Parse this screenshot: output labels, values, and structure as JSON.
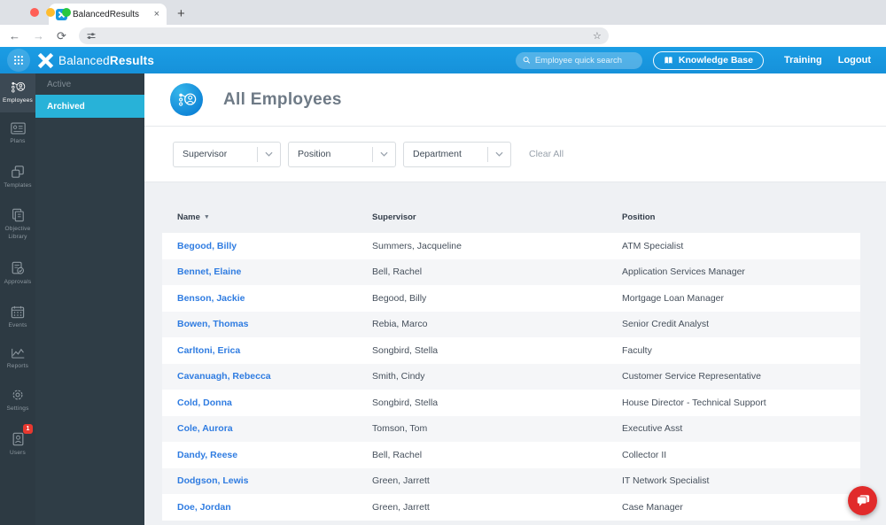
{
  "browser": {
    "tab_title": "BalancedResults",
    "url_value": "",
    "new_tab_label": "+",
    "close_tab_label": "×"
  },
  "header": {
    "brand_first": "Balanced",
    "brand_second": "Results",
    "search_placeholder": "Employee quick search",
    "knowledge_base_label": "Knowledge Base",
    "training_label": "Training",
    "logout_label": "Logout"
  },
  "sidebar": {
    "items": [
      {
        "label": "Employees",
        "active": true
      },
      {
        "label": "Plans"
      },
      {
        "label": "Templates"
      },
      {
        "label": "Objective Library"
      },
      {
        "label": "Approvals"
      },
      {
        "label": "Events"
      },
      {
        "label": "Reports"
      },
      {
        "label": "Settings"
      },
      {
        "label": "Users",
        "badge": "1"
      }
    ]
  },
  "submenu": {
    "items": [
      {
        "label": "Active"
      },
      {
        "label": "Archived",
        "active": true
      }
    ]
  },
  "page": {
    "title": "All Employees"
  },
  "filters": {
    "dropdowns": [
      "Supervisor",
      "Position",
      "Department"
    ],
    "clear_all_label": "Clear All"
  },
  "table": {
    "columns": [
      "Name",
      "Supervisor",
      "Position"
    ],
    "sorted_column": "Name",
    "sort_direction": "asc",
    "rows": [
      {
        "name": "Begood, Billy",
        "supervisor": "Summers, Jacqueline",
        "position": "ATM Specialist"
      },
      {
        "name": "Bennet, Elaine",
        "supervisor": "Bell, Rachel",
        "position": "Application Services Manager"
      },
      {
        "name": "Benson, Jackie",
        "supervisor": "Begood, Billy",
        "position": "Mortgage Loan Manager"
      },
      {
        "name": "Bowen, Thomas",
        "supervisor": "Rebia, Marco",
        "position": "Senior Credit Analyst"
      },
      {
        "name": "Carltoni, Erica",
        "supervisor": "Songbird, Stella",
        "position": "Faculty"
      },
      {
        "name": "Cavanuagh, Rebecca",
        "supervisor": "Smith, Cindy",
        "position": "Customer Service Representative"
      },
      {
        "name": "Cold, Donna",
        "supervisor": "Songbird, Stella",
        "position": "House Director - Technical Support"
      },
      {
        "name": "Cole, Aurora",
        "supervisor": "Tomson, Tom",
        "position": "Executive Asst"
      },
      {
        "name": "Dandy, Reese",
        "supervisor": "Bell, Rachel",
        "position": "Collector II"
      },
      {
        "name": "Dodgson, Lewis",
        "supervisor": "Green, Jarrett",
        "position": "IT Network Specialist"
      },
      {
        "name": "Doe, Jordan",
        "supervisor": "Green, Jarrett",
        "position": "Case Manager"
      }
    ]
  },
  "colors": {
    "header_blue": "#1899e2",
    "submenu_highlight": "#28b2d8",
    "sidebar_dark": "#2d3a43",
    "link_blue": "#2f7ce1",
    "chat_red": "#e12b2b",
    "badge_red": "#e8382f"
  }
}
